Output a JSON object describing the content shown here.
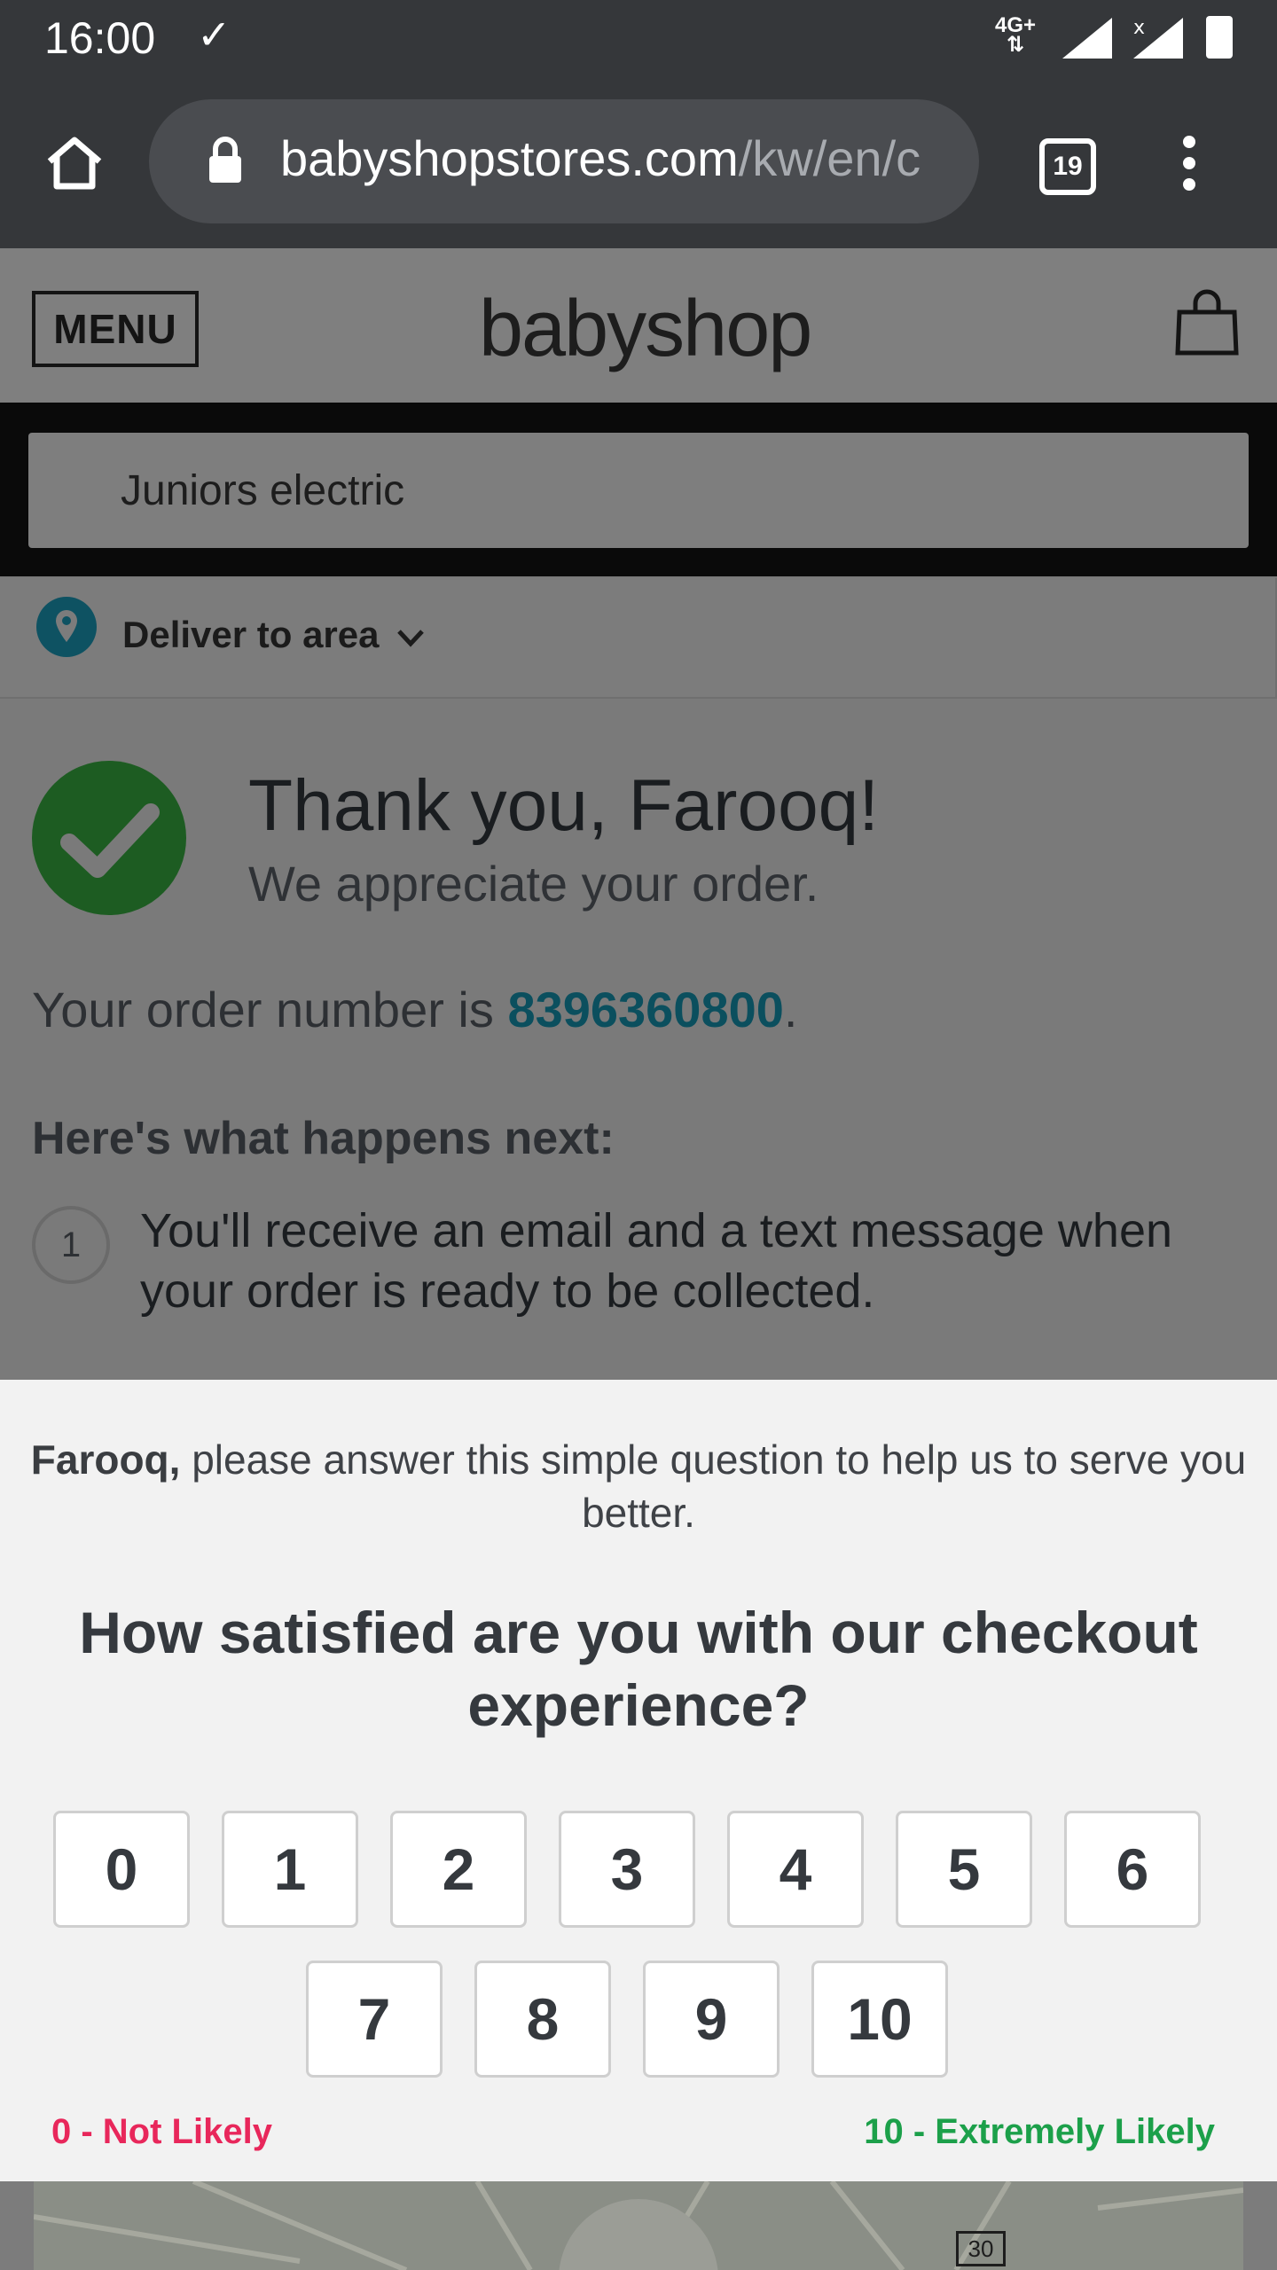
{
  "status_bar": {
    "time": "16:00",
    "network": "4G+"
  },
  "browser": {
    "url_domain": "babyshopstores.com",
    "url_path": "/kw/en/c",
    "tab_count": "19"
  },
  "header": {
    "menu_label": "MENU",
    "logo_text": "babyshop"
  },
  "search": {
    "value": "Juniors electric"
  },
  "delivery": {
    "label": "Deliver to area"
  },
  "confirmation": {
    "title": "Thank you, Farooq!",
    "subtitle": "We appreciate your order.",
    "order_prefix": "Your order number is ",
    "order_number": "8396360800",
    "order_suffix": ".",
    "next_heading": "Here's what happens next:",
    "steps": [
      {
        "number": "1",
        "text": "You'll receive an email and a text message when your order is ready to be collected."
      }
    ]
  },
  "survey": {
    "intro_name": "Farooq,",
    "intro_text": " please answer this simple question to help us to serve you better.",
    "question": "How satisfied are you with our checkout experience?",
    "scores": [
      "0",
      "1",
      "2",
      "3",
      "4",
      "5",
      "6",
      "7",
      "8",
      "9",
      "10"
    ],
    "label_low": "0 - Not Likely",
    "label_high": "10 - Extremely Likely"
  },
  "map": {
    "road_number": "30"
  },
  "colors": {
    "link": "#0b4f5e",
    "low": "#e8275b",
    "high": "#1ca04a",
    "success": "#1d5c22"
  }
}
